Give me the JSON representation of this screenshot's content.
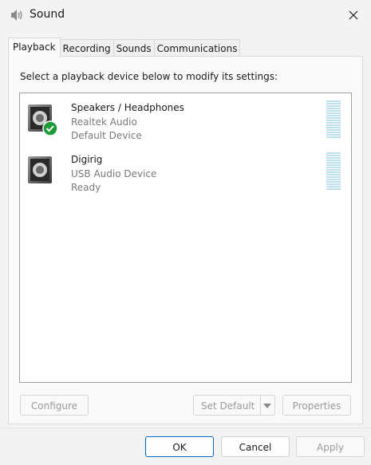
{
  "window": {
    "title": "Sound",
    "icon": "speaker-icon",
    "close_icon": "close-icon"
  },
  "tabs": [
    {
      "label": "Playback",
      "active": true
    },
    {
      "label": "Recording",
      "active": false
    },
    {
      "label": "Sounds",
      "active": false
    },
    {
      "label": "Communications",
      "active": false
    }
  ],
  "instruction": "Select a playback device below to modify its settings:",
  "devices": [
    {
      "name": "Speakers / Headphones",
      "driver": "Realtek Audio",
      "status": "Default Device",
      "default_badge": "check-icon",
      "badge_color": "#1e9a3a"
    },
    {
      "name": "Digirig",
      "driver": "USB Audio Device",
      "status": "Ready"
    }
  ],
  "buttons": {
    "configure": "Configure",
    "set_default": "Set Default",
    "properties": "Properties",
    "ok": "OK",
    "cancel": "Cancel",
    "apply": "Apply"
  },
  "colors": {
    "accent": "#0067c0",
    "meter": "#bfe0ef",
    "disabled_text": "#9a9a9a"
  }
}
